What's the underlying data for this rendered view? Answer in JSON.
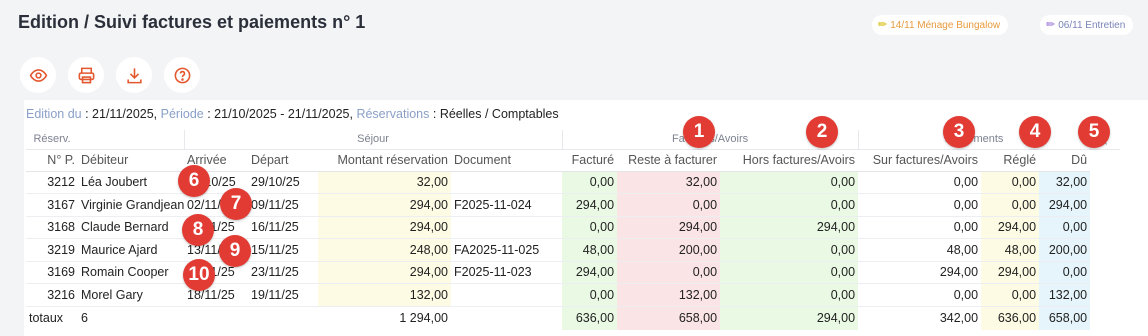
{
  "header": {
    "title": "Edition / Suivi factures et paiements n° 1",
    "chips": [
      "14/11 Ménage Bungalow",
      "06/11 Entretien"
    ]
  },
  "toolbar": {
    "icons": [
      "eye-icon",
      "printer-icon",
      "download-icon",
      "help-icon"
    ]
  },
  "filters": {
    "edition_label": "Edition du",
    "edition_value": ": 21/11/2025,",
    "periode_label": "Période",
    "periode_value": ": 21/10/2025 - 21/11/2025,",
    "reservations_label": "Réservations",
    "reservations_value": ": Réelles / Comptables"
  },
  "table": {
    "groups": {
      "reserv": "Réserv.",
      "sejour": "Séjour",
      "factures": "Factures/Avoirs",
      "reglements": "Règlements",
      "end": "("
    },
    "columns": {
      "num": "N° P.",
      "debiteur": "Débiteur",
      "arrivee": "Arrivée",
      "depart": "Départ",
      "montant": "Montant réservation",
      "document": "Document",
      "facture": "Facturé",
      "reste": "Reste à facturer",
      "hors": "Hors factures/Avoirs",
      "sur": "Sur factures/Avoirs",
      "regle": "Réglé",
      "du": "Dû"
    },
    "rows": [
      {
        "num": "3212",
        "debiteur": "Léa Joubert",
        "arrivee": "28/10/25",
        "depart": "29/10/25",
        "montant": "32,00",
        "document": "",
        "facture": "0,00",
        "reste": "32,00",
        "hors": "0,00",
        "sur": "0,00",
        "regle": "0,00",
        "du": "32,00"
      },
      {
        "num": "3167",
        "debiteur": "Virginie Grandjean",
        "arrivee": "02/11/25",
        "depart": "09/11/25",
        "montant": "294,00",
        "document": "F2025-11-024",
        "facture": "294,00",
        "reste": "0,00",
        "hors": "0,00",
        "sur": "0,00",
        "regle": "0,00",
        "du": "294,00"
      },
      {
        "num": "3168",
        "debiteur": "Claude Bernard",
        "arrivee": "09/11/25",
        "depart": "16/11/25",
        "montant": "294,00",
        "document": "",
        "facture": "0,00",
        "reste": "294,00",
        "hors": "294,00",
        "sur": "0,00",
        "regle": "294,00",
        "du": "0,00"
      },
      {
        "num": "3219",
        "debiteur": "Maurice Ajard",
        "arrivee": "13/11/25",
        "depart": "15/11/25",
        "montant": "248,00",
        "document": "FA2025-11-025",
        "facture": "48,00",
        "reste": "200,00",
        "hors": "0,00",
        "sur": "48,00",
        "regle": "48,00",
        "du": "200,00"
      },
      {
        "num": "3169",
        "debiteur": "Romain Cooper",
        "arrivee": "16/11/25",
        "depart": "23/11/25",
        "montant": "294,00",
        "document": "F2025-11-023",
        "facture": "294,00",
        "reste": "0,00",
        "hors": "0,00",
        "sur": "294,00",
        "regle": "294,00",
        "du": "0,00"
      },
      {
        "num": "3216",
        "debiteur": "Morel Gary",
        "arrivee": "18/11/25",
        "depart": "19/11/25",
        "montant": "132,00",
        "document": "",
        "facture": "0,00",
        "reste": "132,00",
        "hors": "0,00",
        "sur": "0,00",
        "regle": "0,00",
        "du": "132,00"
      }
    ],
    "totals": {
      "label": "totaux",
      "count": "6",
      "montant": "1 294,00",
      "facture": "636,00",
      "reste": "658,00",
      "hors": "294,00",
      "sur": "342,00",
      "regle": "636,00",
      "du": "658,00"
    }
  },
  "badges": [
    "1",
    "2",
    "3",
    "4",
    "5",
    "6",
    "7",
    "8",
    "9",
    "10"
  ],
  "colors": {
    "badge": "#e23b34",
    "montant_bg": "#fdfbe3",
    "facture_bg": "#eaf9e4",
    "reste_bg": "#fbe4e5",
    "hors_bg": "#eaf9e4",
    "regle_bg": "#fdfbe3",
    "du_bg": "#e6f5fb"
  }
}
